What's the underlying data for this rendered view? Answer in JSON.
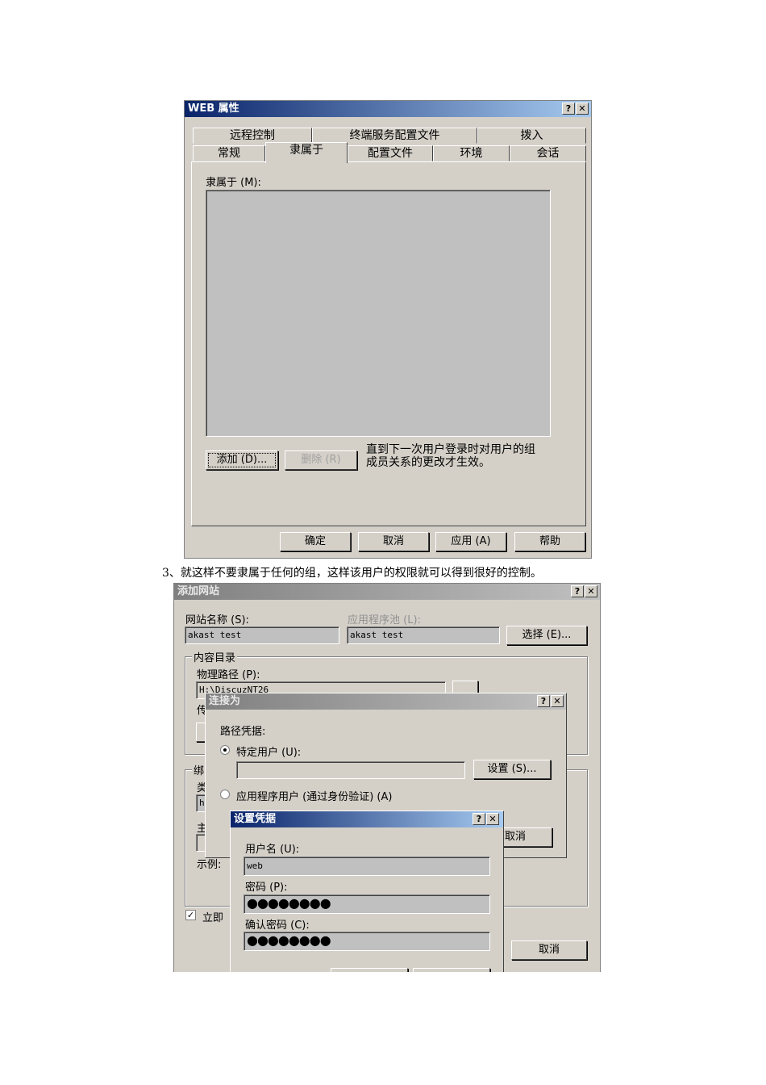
{
  "dialog1": {
    "title": "WEB 属性",
    "help_btn": "?",
    "close_btn": "✕",
    "tabs_row1": [
      "远程控制",
      "终端服务配置文件",
      "拨入"
    ],
    "tabs_row2": [
      "常规",
      "隶属于",
      "配置文件",
      "环境",
      "会话"
    ],
    "member_of_label": "隶属于 (M):",
    "add_button": "添加 (D)...",
    "remove_button": "删除 (R)",
    "note_line1": "直到下一次用户登录时对用户的组",
    "note_line2": "成员关系的更改才生效。",
    "ok_button": "确定",
    "cancel_button": "取消",
    "apply_button": "应用 (A)",
    "help_button": "帮助"
  },
  "caption": "3、就这样不要隶属于任何的组，这样该用户的权限就可以得到很好的控制。",
  "dialog2": {
    "title": "添加网站",
    "help_btn": "?",
    "close_btn": "✕",
    "site_name_label": "网站名称 (S):",
    "site_name_value": "akast test",
    "app_pool_label": "应用程序池 (L):",
    "app_pool_value": "akast test",
    "select_button": "选择 (E)...",
    "content_dir_group": "内容目录",
    "physical_path_label": "物理路径 (P):",
    "physical_path_value": "H:\\DiscuzNT26",
    "partial_label_1": "传",
    "binding_group": "绑",
    "partial_label_2": "类",
    "partial_value_2": "h",
    "partial_label_3": "主",
    "example_label": "示例:",
    "start_checkbox_label": "立即",
    "cancel_button": "取消"
  },
  "dialog3": {
    "title": "连接为",
    "help_btn": "?",
    "close_btn": "✕",
    "path_credentials_label": "路径凭据:",
    "specific_user_label": "特定用户 (U):",
    "set_button": "设置 (S)...",
    "app_user_label": "应用程序用户 (通过身份验证) (A)",
    "cancel_button_partial": "取消"
  },
  "dialog4": {
    "title": "设置凭据",
    "help_btn": "?",
    "close_btn": "✕",
    "username_label": "用户名 (U):",
    "username_value": "web",
    "password_label": "密码 (P):",
    "password_value": "●●●●●●●●",
    "confirm_label": "确认密码 (C):",
    "confirm_value": "●●●●●●●●"
  }
}
